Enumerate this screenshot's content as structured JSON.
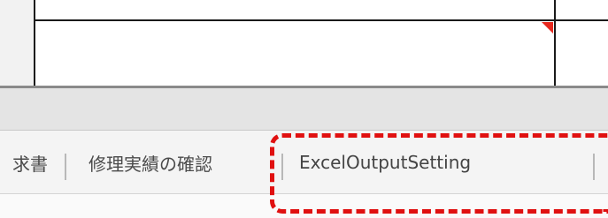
{
  "tabs": [
    {
      "label": "求書",
      "partial": true
    },
    {
      "label": "修理実績の確認"
    },
    {
      "label": "ExcelOutputSetting",
      "highlighted": true
    }
  ],
  "colors": {
    "highlight_border": "#e01010",
    "cell_marker": "#e8281e",
    "tab_strip_background": "#f4f4f4",
    "band_background": "#e4e4e4"
  }
}
